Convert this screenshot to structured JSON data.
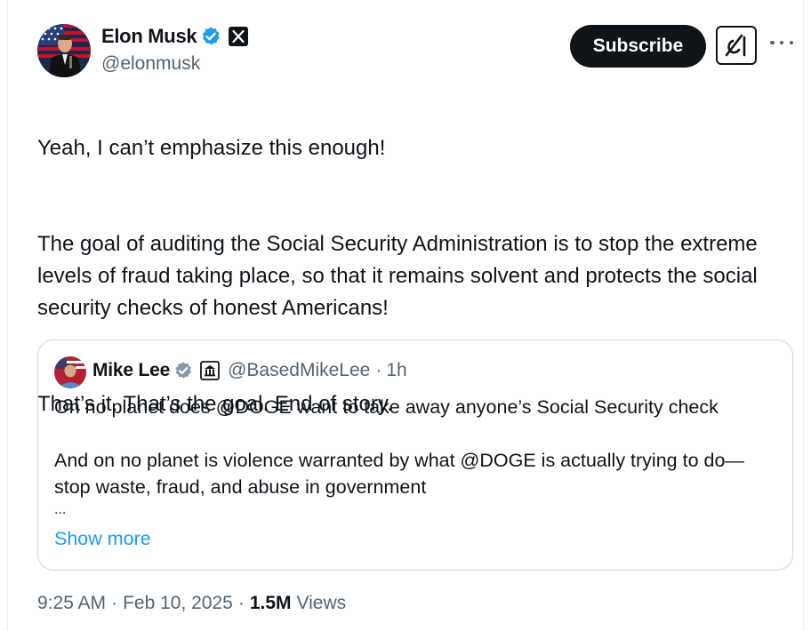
{
  "author": {
    "display_name": "Elon Musk",
    "handle": "@elonmusk",
    "verified_icon": "verified-badge-blue",
    "affiliate_icon": "x-logo"
  },
  "actions": {
    "subscribe_label": "Subscribe",
    "grok_icon": "grok-icon",
    "more_icon": "more-options-icon"
  },
  "tweet": {
    "paragraphs": [
      "Yeah, I can’t emphasize this enough!",
      "The goal of auditing the Social Security Administration is to stop the extreme levels of fraud taking place, so that it remains solvent and protects the social security checks of honest Americans!",
      "That’s it. That’s the goal. End of story."
    ]
  },
  "quote": {
    "display_name": "Mike Lee",
    "handle": "@BasedMikeLee",
    "time": "1h",
    "paragraph_1": "On no planet does @DOGE want to take away anyone’s Social Security check",
    "paragraph_2": "And on no planet is violence warranted by what @DOGE is actually trying to do—stop waste, fraud, and abuse in government",
    "ellipsis": "...",
    "show_more": "Show more"
  },
  "meta": {
    "time": "9:25 AM",
    "date": "Feb 10, 2025",
    "views_count": "1.5M",
    "views_label": "Views"
  },
  "colors": {
    "text": "#0f1419",
    "secondary": "#536471",
    "link": "#1d9bf0",
    "verified": "#1d9bf0",
    "border": "#cfd9de"
  }
}
